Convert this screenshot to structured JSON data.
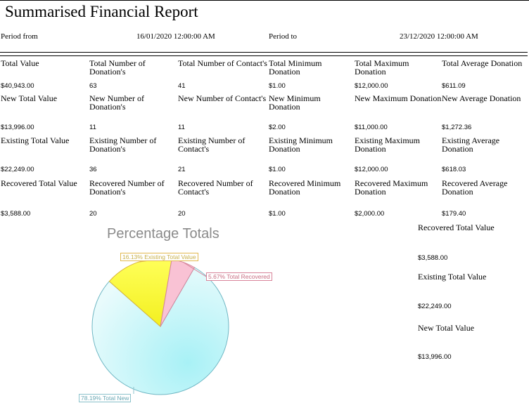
{
  "report": {
    "title": "Summarised Financial Report"
  },
  "period": {
    "from_label": "Period from",
    "from_value": "16/01/2020 12:00:00 AM",
    "to_label": "Period to",
    "to_value": "23/12/2020 12:00:00 AM"
  },
  "rows": [
    {
      "headers": [
        "Total Value",
        "Total Number of Donation's",
        "Total Number of Contact's",
        "Total Minimum Donation",
        "Total Maximum Donation",
        "Total Average Donation"
      ],
      "values": [
        "$40,943.00",
        "63",
        "41",
        "$1.00",
        "$12,000.00",
        "$611.09"
      ]
    },
    {
      "headers": [
        "New Total Value",
        "New Number of Donation's",
        "New Number of Contact's",
        "New Minimum Donation",
        "New Maximum Donation",
        "New Average Donation"
      ],
      "values": [
        "$13,996.00",
        "11",
        "11",
        "$2.00",
        "$11,000.00",
        "$1,272.36"
      ]
    },
    {
      "headers": [
        "Existing Total Value",
        "Existing Number of Donation's",
        "Existing Number of Contact's",
        "Existing Minimum Donation",
        "Existing Maximum Donation",
        "Existing Average Donation"
      ],
      "values": [
        "$22,249.00",
        "36",
        "21",
        "$1.00",
        "$12,000.00",
        "$618.03"
      ]
    },
    {
      "headers": [
        "Recovered Total Value",
        "Recovered Number of Donation's",
        "Recovered Number of Contact's",
        "Recovered Minimum Donation",
        "Recovered Maximum Donation",
        "Recovered Average Donation"
      ],
      "values": [
        "$3,588.00",
        "20",
        "20",
        "$1.00",
        "$2,000.00",
        "$179.40"
      ]
    }
  ],
  "side": [
    {
      "label": "Recovered Total Value",
      "value": "$3,588.00"
    },
    {
      "label": "Existing Total Value",
      "value": "$22,249.00"
    },
    {
      "label": "New Total Value",
      "value": "$13,996.00"
    }
  ],
  "chart_data": {
    "type": "pie",
    "title": "Percentage Totals",
    "slices": [
      {
        "label": "78.19% Total New",
        "value": 78.19,
        "color": "#c4f4f7",
        "border": "#6fb7c4"
      },
      {
        "label": "16.13% Existing Total Value",
        "value": 16.13,
        "color": "#fbfb3c",
        "border": "#d9b43a"
      },
      {
        "label": "5.67% Total Recovered",
        "value": 5.67,
        "color": "#f9c2d4",
        "border": "#d3869c"
      }
    ]
  }
}
